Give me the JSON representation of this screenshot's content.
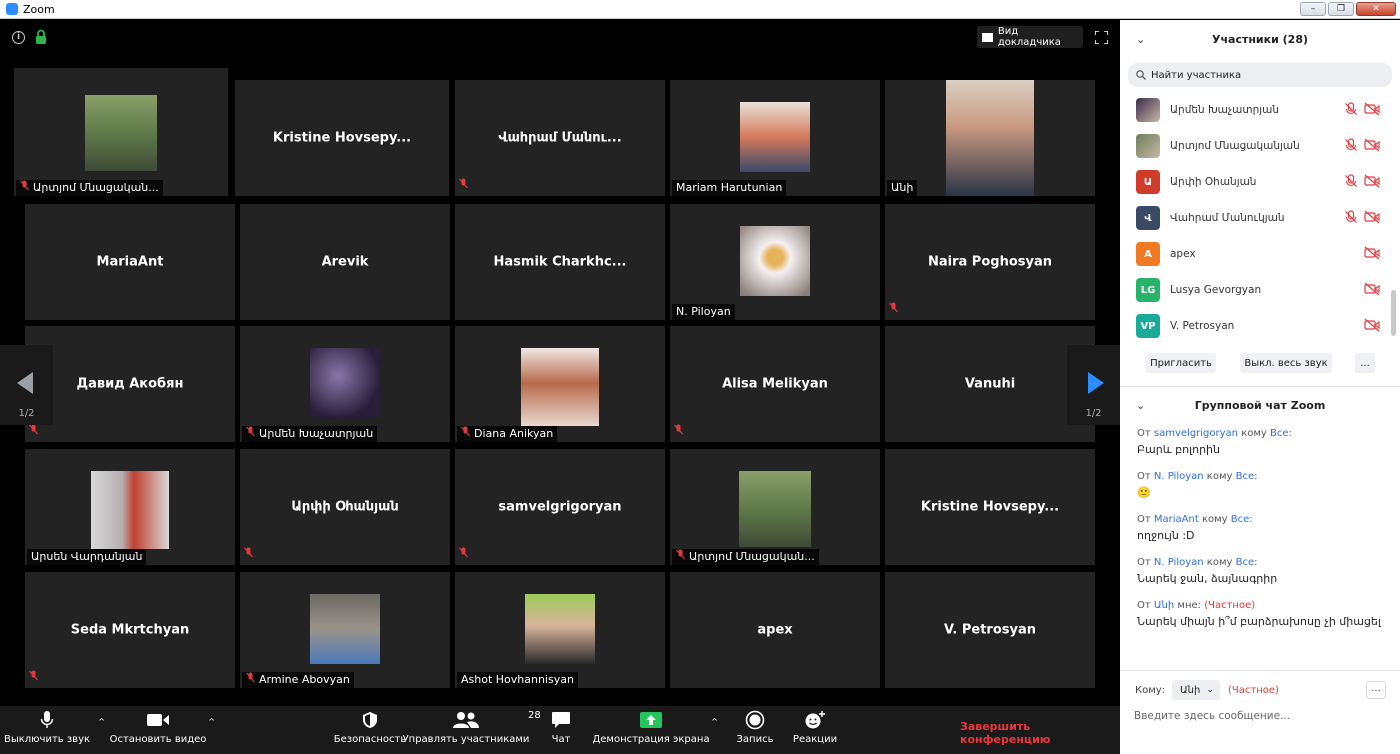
{
  "window": {
    "title": "Zoom"
  },
  "video": {
    "speaker_view_label": "Вид докладчика",
    "page_left": "1/2",
    "page_right": "1/2",
    "tiles": [
      {
        "center": "",
        "label": "Արտյոմ Մնացական...",
        "photo": "park-man",
        "muted": true
      },
      {
        "center": "Kristine  Hovsepy...",
        "label": "",
        "photo": "",
        "muted": false
      },
      {
        "center": "Վահրամ Մանու...",
        "label": "",
        "photo": "",
        "muted": true
      },
      {
        "center": "",
        "label": "Mariam Harutunian",
        "photo": "girl-sitting",
        "muted": false
      },
      {
        "center": "",
        "label": "Անի",
        "photo": "girl-glasses",
        "muted": false
      },
      {
        "center": "MariaAnt",
        "label": "",
        "photo": "",
        "muted": false
      },
      {
        "center": "Arevik",
        "label": "",
        "photo": "",
        "muted": false
      },
      {
        "center": "Hasmik  Charkhc...",
        "label": "",
        "photo": "",
        "muted": false
      },
      {
        "center": "",
        "label": "N. Piloyan",
        "photo": "bee-flower",
        "muted": false
      },
      {
        "center": "Naira Poghosyan",
        "label": "",
        "photo": "",
        "muted": true
      },
      {
        "center": "Давид Акобян",
        "label": "",
        "photo": "",
        "muted": true
      },
      {
        "center": "",
        "label": "Արմեն Խաչատրյան",
        "photo": "silhouette",
        "muted": true
      },
      {
        "center": "",
        "label": "Diana Anikyan",
        "photo": "woman-hair",
        "muted": true
      },
      {
        "center": "Alisa Melikyan",
        "label": "",
        "photo": "",
        "muted": true
      },
      {
        "center": "Vanuhi",
        "label": "",
        "photo": "",
        "muted": false
      },
      {
        "center": "",
        "label": "Արսեն Վարդանյան",
        "photo": "man-striped",
        "muted": false
      },
      {
        "center": "Արփի Օհանյան",
        "label": "",
        "photo": "",
        "muted": true
      },
      {
        "center": "samvelgrigoryan",
        "label": "",
        "photo": "",
        "muted": true
      },
      {
        "center": "",
        "label": "Արտյոմ Մնացական...",
        "photo": "park-man",
        "muted": true
      },
      {
        "center": "Kristine  Hovsepy...",
        "label": "",
        "photo": "",
        "muted": false
      },
      {
        "center": "Seda Mkrtchyan",
        "label": "",
        "photo": "",
        "muted": true
      },
      {
        "center": "",
        "label": "Armine Abovyan",
        "photo": "woman-arch",
        "muted": true
      },
      {
        "center": "",
        "label": "Ashot Hovhannisyan",
        "photo": "man-sweater",
        "muted": false
      },
      {
        "center": "apex",
        "label": "",
        "photo": "",
        "muted": false
      },
      {
        "center": "V. Petrosyan",
        "label": "",
        "photo": "",
        "muted": false
      }
    ]
  },
  "toolbar": {
    "mute_label": "Выключить звук",
    "video_label": "Остановить видео",
    "security_label": "Безопасность",
    "participants_label": "Управлять участниками",
    "participants_count": "28",
    "chat_label": "Чат",
    "share_label": "Демонстрация экрана",
    "record_label": "Запись",
    "reactions_label": "Реакции",
    "end_label": "Завершить конференцию"
  },
  "participants_panel": {
    "title": "Участники (28)",
    "search_placeholder": "Найти участника",
    "items": [
      {
        "initials": "",
        "name": "Արմեն Խաչատրյան",
        "color": "#3a2a4a",
        "mic_muted": true,
        "photo": true
      },
      {
        "initials": "",
        "name": "Արտյոմ Մնացականյան",
        "color": "#6b7d5a",
        "mic_muted": true,
        "photo": true
      },
      {
        "initials": "Ա",
        "name": "Արփի Օհանյան",
        "color": "#d13b2a",
        "mic_muted": true,
        "photo": false
      },
      {
        "initials": "Վ",
        "name": "Վահրամ Մանուկյան",
        "color": "#3b4a64",
        "mic_muted": true,
        "photo": false
      },
      {
        "initials": "A",
        "name": "apex",
        "color": "#f07a22",
        "mic_muted": false,
        "photo": false
      },
      {
        "initials": "LG",
        "name": "Lusya Gevorgyan",
        "color": "#27b36a",
        "mic_muted": false,
        "photo": false
      },
      {
        "initials": "VP",
        "name": "V. Petrosyan",
        "color": "#1aaa9a",
        "mic_muted": false,
        "photo": false
      }
    ],
    "invite_label": "Пригласить",
    "mute_all_label": "Выкл. весь звук",
    "more_label": "..."
  },
  "chat_panel": {
    "title": "Групповой чат Zoom",
    "messages": [
      {
        "from_prefix": "От",
        "from": "samvelgrigoryan",
        "to_prefix": "кому",
        "to": "Все:",
        "private": "",
        "text": "Բարև բոլորին"
      },
      {
        "from_prefix": "От",
        "from": "N. Piloyan",
        "to_prefix": "кому",
        "to": "Все:",
        "private": "",
        "text": "🙂"
      },
      {
        "from_prefix": "От",
        "from": "MariaAnt",
        "to_prefix": "кому",
        "to": "Все:",
        "private": "",
        "text": "ողջույն :D"
      },
      {
        "from_prefix": "От",
        "from": "N. Piloyan",
        "to_prefix": "кому",
        "to": "Все:",
        "private": "",
        "text": "Նարեկ ջան, ձայնագրիր"
      },
      {
        "from_prefix": "От",
        "from": "Անի",
        "to_prefix": "мне:",
        "to": "",
        "private": "(Частное)",
        "text": "Նարեկ միայն ի՞մ բարձրախոսը չի միացել"
      }
    ],
    "to_label": "Кому:",
    "to_value": "Անի",
    "to_private": "(Частное)",
    "more_label": "...",
    "input_placeholder": "Введите здесь сообщение..."
  }
}
